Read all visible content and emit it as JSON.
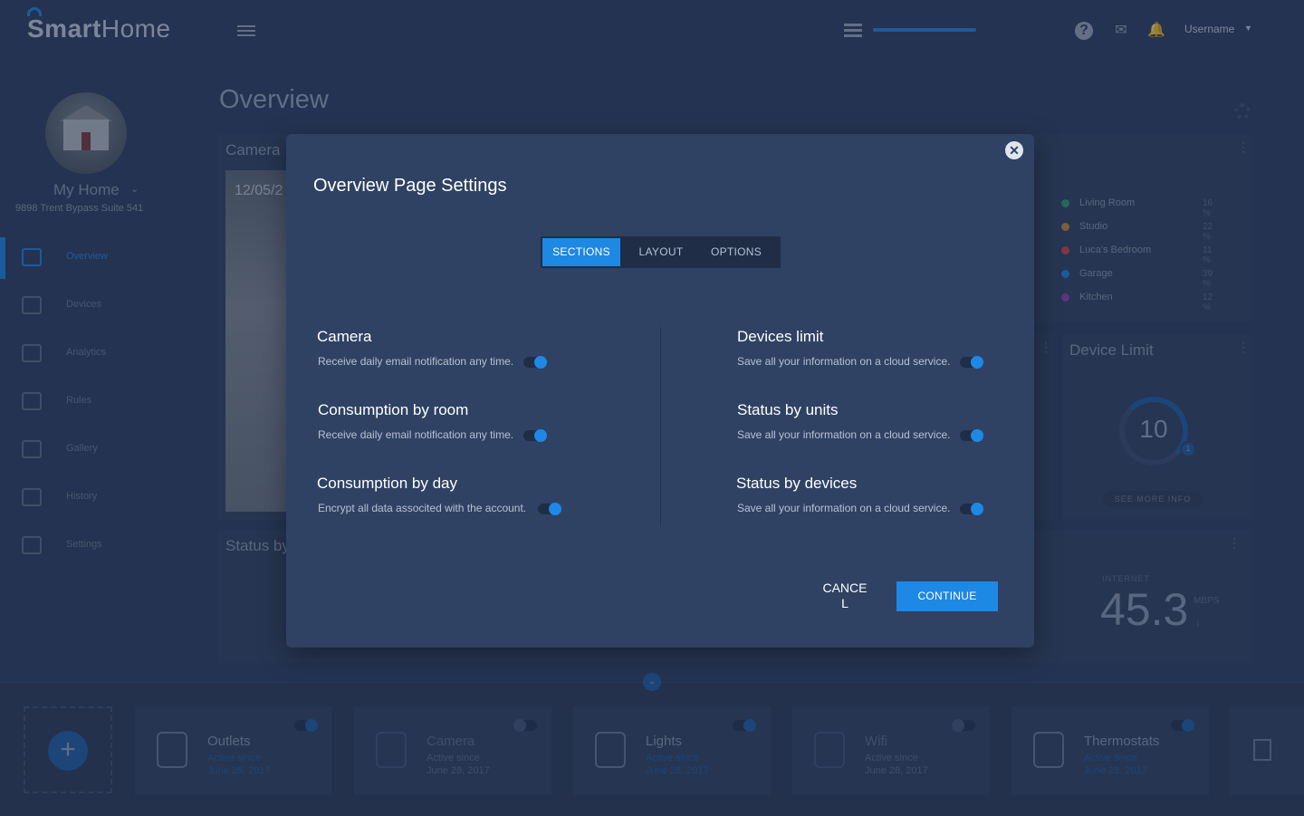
{
  "app": {
    "logo_bold": "Smart",
    "logo_light": "Home",
    "username": "Username",
    "top_progress_fraction": 1.0
  },
  "sidebar": {
    "home_name": "My Home",
    "home_address": "9898 Trent Bypass Suite 541",
    "items": [
      {
        "label": "Overview",
        "icon": "home-icon",
        "active": true
      },
      {
        "label": "Devices",
        "icon": "devices-icon"
      },
      {
        "label": "Analytics",
        "icon": "chart-icon"
      },
      {
        "label": "Rules",
        "icon": "rules-icon"
      },
      {
        "label": "Gallery",
        "icon": "gallery-icon"
      },
      {
        "label": "History",
        "icon": "history-icon"
      },
      {
        "label": "Settings",
        "icon": "gear-icon"
      }
    ]
  },
  "main": {
    "page_title": "Overview",
    "camera_card": {
      "title": "Camera",
      "date": "12/05/2"
    },
    "rooms_legend": [
      {
        "label": "Living Room",
        "pct": "16 %",
        "color": "#2e9e6a"
      },
      {
        "label": "Studio",
        "pct": "22 %",
        "color": "#c98a3a"
      },
      {
        "label": "Luca's Bedroom",
        "pct": "11 %",
        "color": "#d04848"
      },
      {
        "label": "Garage",
        "pct": "39 %",
        "color": "#1e88e5"
      },
      {
        "label": "Kitchen",
        "pct": "12 %",
        "color": "#8e44ad"
      }
    ],
    "device_limit": {
      "title": "Device Limit",
      "value": "10",
      "badge": "1",
      "link": "SEE MORE INFO"
    },
    "status_card": {
      "title": "Status by"
    },
    "internet": {
      "label": "INTERNET",
      "value": "45.3",
      "unit": "MBPS",
      "arrow": "↓"
    }
  },
  "devices_strip": [
    {
      "name": "Outlets",
      "status": "Active since",
      "date": "June 28, 2017",
      "on": true,
      "icon": "outlet-icon"
    },
    {
      "name": "Camera",
      "status": "Active since",
      "date": "June 28, 2017",
      "on": false,
      "icon": "camera-icon"
    },
    {
      "name": "Lights",
      "status": "Active since",
      "date": "June 28, 2017",
      "on": true,
      "icon": "lightbulb-icon"
    },
    {
      "name": "Wifi",
      "status": "Active since",
      "date": "June 28, 2017",
      "on": false,
      "icon": "wifi-icon"
    },
    {
      "name": "Thermostats",
      "status": "Active since",
      "date": "June 28, 2017",
      "on": true,
      "icon": "thermometer-icon"
    }
  ],
  "modal": {
    "title": "Overview Page Settings",
    "tabs": [
      {
        "label": "SECTIONS",
        "active": true
      },
      {
        "label": "LAYOUT"
      },
      {
        "label": "OPTIONS"
      }
    ],
    "left_settings": [
      {
        "title": "Camera",
        "desc": "Receive daily email notification any time.",
        "enabled": true
      },
      {
        "title": "Consumption by room",
        "desc": "Receive daily email notification any time.",
        "enabled": true
      },
      {
        "title": "Consumption by day",
        "desc": "Encrypt all data associted with the account.",
        "enabled": true
      }
    ],
    "right_settings": [
      {
        "title": "Devices limit",
        "desc": "Save all your information on a cloud service.",
        "enabled": true
      },
      {
        "title": "Status by units",
        "desc": "Save all your information on a cloud service.",
        "enabled": true
      },
      {
        "title": "Status by devices",
        "desc": "Save all your information on a cloud service.",
        "enabled": true
      }
    ],
    "cancel_label": "CANCEL",
    "continue_label": "CONTINUE"
  },
  "colors": {
    "accent": "#1e88e5",
    "background": "#2c3e5f",
    "modal": "#2f4263"
  }
}
